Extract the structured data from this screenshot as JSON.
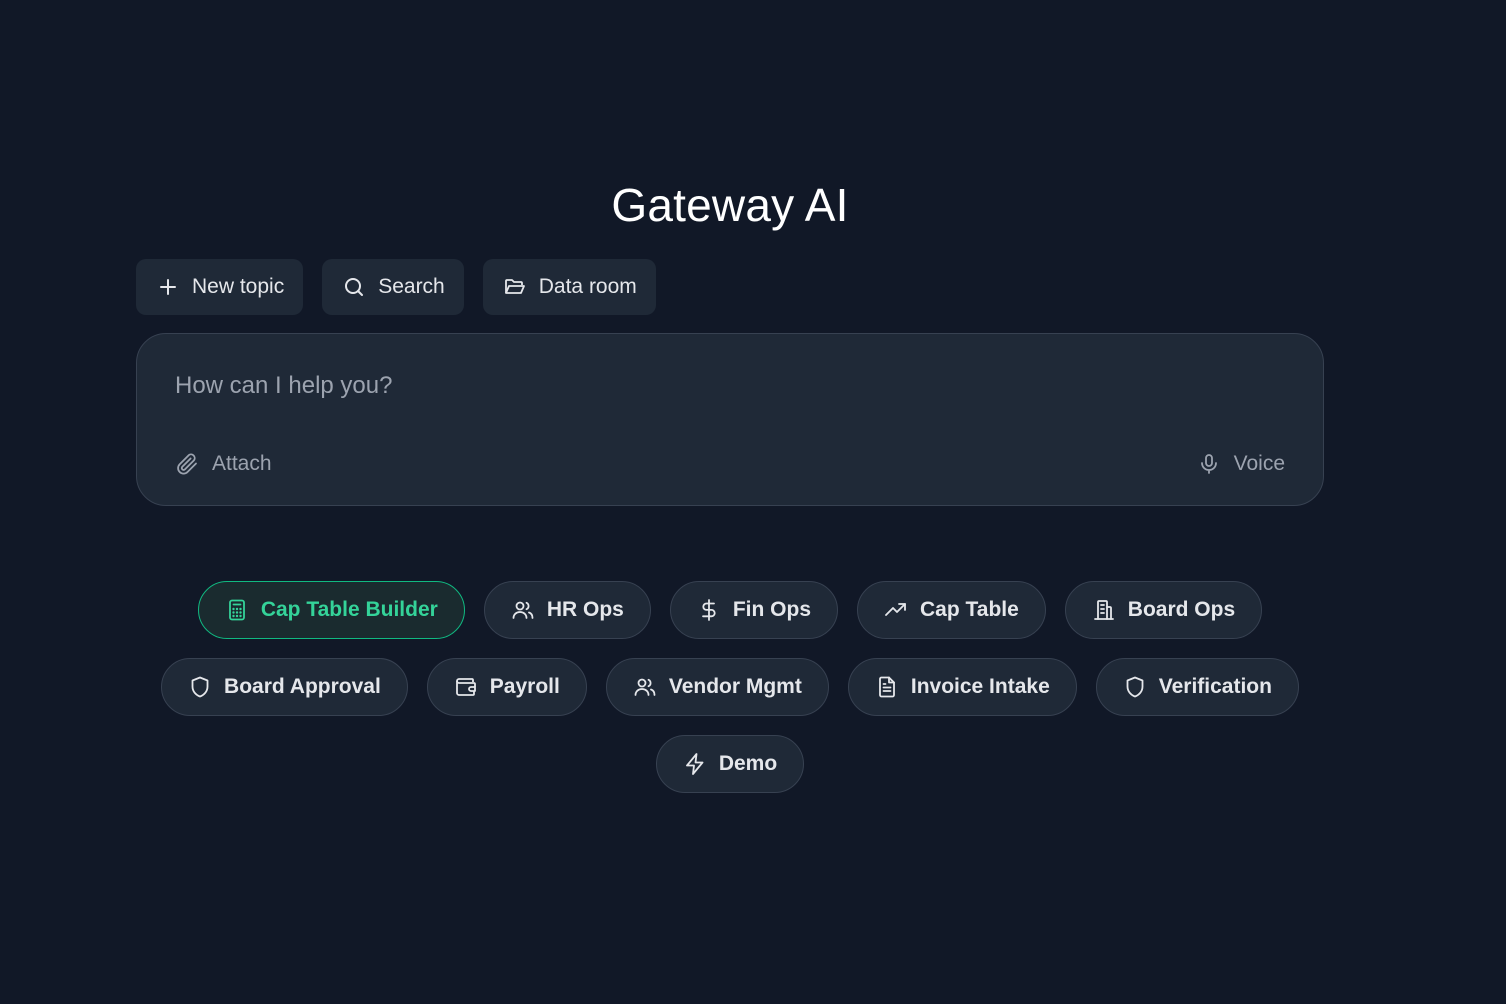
{
  "app": {
    "title": "Gateway AI"
  },
  "toolbar": {
    "new_topic": "New topic",
    "search": "Search",
    "data_room": "Data room"
  },
  "composer": {
    "placeholder": "How can I help you?",
    "attach_label": "Attach",
    "voice_label": "Voice"
  },
  "chips": {
    "row1": [
      {
        "label": "Cap Table Builder",
        "icon": "calculator-icon",
        "active": true
      },
      {
        "label": "HR Ops",
        "icon": "users-icon"
      },
      {
        "label": "Fin Ops",
        "icon": "dollar-icon"
      },
      {
        "label": "Cap Table",
        "icon": "trending-up-icon"
      },
      {
        "label": "Board Ops",
        "icon": "building-icon"
      }
    ],
    "row2": [
      {
        "label": "Board Approval",
        "icon": "shield-icon"
      },
      {
        "label": "Payroll",
        "icon": "wallet-icon"
      },
      {
        "label": "Vendor Mgmt",
        "icon": "users-icon"
      },
      {
        "label": "Invoice Intake",
        "icon": "file-text-icon"
      },
      {
        "label": "Verification",
        "icon": "shield-icon"
      }
    ],
    "row3": [
      {
        "label": "Demo",
        "icon": "zap-icon"
      }
    ]
  },
  "colors": {
    "background": "#111827",
    "surface": "#1f2937",
    "border": "#374151",
    "accent": "#34d399"
  }
}
